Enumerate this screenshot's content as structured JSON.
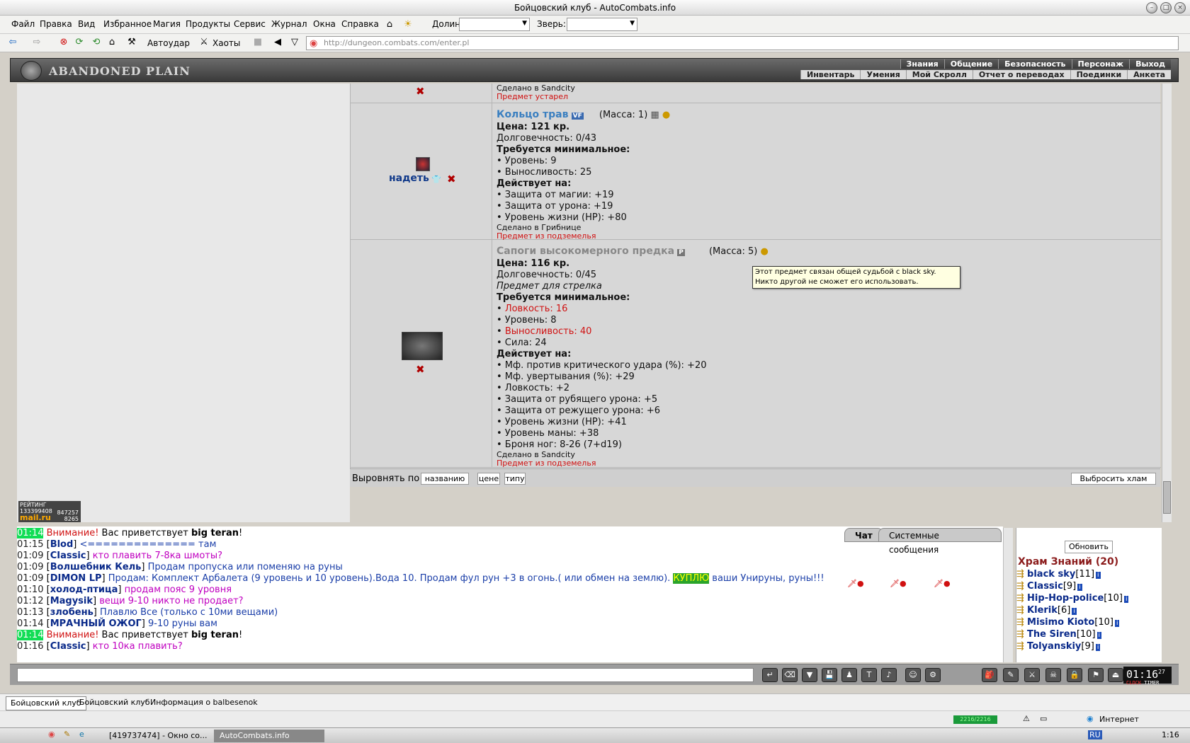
{
  "window": {
    "title": "Бойцовский клуб - AutoCombats.info"
  },
  "menu": {
    "items": [
      "Файл",
      "Правка",
      "Вид",
      "Избранное",
      "Магия",
      "Продукты",
      "Сервис",
      "Журнал",
      "Окна",
      "Справка"
    ],
    "dolin_label": "Долин:",
    "zver_label": "Зверь:"
  },
  "toolbar": {
    "autoudar": "Автоудар",
    "haoty": "Хаоты",
    "url": "http://dungeon.combats.com/enter.pl"
  },
  "game": {
    "logo": "ABANDONED PLAIN",
    "nav_top": [
      "Знания",
      "Общение",
      "Безопасность",
      "Персонаж",
      "Выход"
    ],
    "nav_bottom": [
      "Инвентарь",
      "Умения",
      "Мой Скролл",
      "Отчет о переводах",
      "Поединки",
      "Анкета"
    ]
  },
  "item0": {
    "made": "Сделано в Sandcity",
    "old": "Предмет устарел"
  },
  "item1": {
    "name": "Кольцо трав",
    "badge": "VF",
    "mass": "(Масса: 1)",
    "price": "Цена: 121 кр.",
    "durability": "Долговечность: 0/43",
    "req_title": "Требуется минимальное:",
    "req": [
      "• Уровень: 9",
      "• Выносливость: 25"
    ],
    "acts_title": "Действует на:",
    "acts": [
      "• Защита от магии: +19",
      "• Защита от урона: +19",
      "• Уровень жизни (HP): +80"
    ],
    "made": "Сделано в Грибнице",
    "origin": "Предмет из подземелья",
    "action": "надеть"
  },
  "item2": {
    "name": "Сапоги высокомерного предка",
    "badge": "P",
    "mass": "(Масса: 5)",
    "price": "Цена: 116 кр.",
    "durability": "Долговечность: 0/45",
    "class": "Предмет для стрелка",
    "req_title": "Требуется минимальное:",
    "req_red1": "Ловкость: 16",
    "req2": "• Уровень: 8",
    "req_red2": "Выносливость: 40",
    "req4": "• Сила: 24",
    "acts_title": "Действует на:",
    "acts": [
      "• Мф. против критического удара (%): +20",
      "• Мф. увертывания (%): +29",
      "• Ловкость: +2",
      "• Защита от рубящего урона: +5",
      "• Защита от режущего урона: +6",
      "• Уровень жизни (HP): +41",
      "• Уровень маны: +38",
      "• Броня ног: 8-26 (7+d19)"
    ],
    "made": "Сделано в Sandcity",
    "origin": "Предмет из подземелья"
  },
  "tooltip": "Этот предмет связан общей судьбой с black sky. Никто другой не сможет его использовать.",
  "sort": {
    "label": "Выровнять по",
    "by_name": "названию",
    "by_price": "цене",
    "by_type": "типу",
    "discard": "Выбросить хлам"
  },
  "rating": {
    "line1": "РЕЙТИНГ 133399408",
    "line2": "mail.ru",
    "n1": "847257",
    "n2": "8265"
  },
  "chat": {
    "tabs": [
      "Чат",
      "Системные сообщения"
    ],
    "lines": [
      {
        "time": "01:14",
        "hl": true,
        "attn": "Внимание!",
        "text": " Вас приветствует ",
        "bold": "big teran",
        "end": "!"
      },
      {
        "time": "01:15",
        "nick": "Blod",
        "text": " <============== там",
        "cls": "msgblue"
      },
      {
        "time": "01:09",
        "nick": "CIassic",
        "text": " кто плавить 7-8ка шмоты?",
        "cls": "msgpurp"
      },
      {
        "time": "01:09",
        "nick": "Волшебник Кель",
        "text": " Продам пропуска или поменяю на руны",
        "cls": "msgblue"
      },
      {
        "time": "01:09",
        "nick": "DIMON LP",
        "text": " Продам: Комплект Арбалета (9 уровень и 10 уровень).Вода 10. Продам фул рун +3 в огонь.( или обмен на землю). ",
        "buy": "КУПЛЮ",
        "tail": " ваши Унируны, руны!!!",
        "cls": "msgblue"
      },
      {
        "time": "01:10",
        "nick": "холод-птица",
        "text": " продам пояс 9 уровня",
        "cls": "msgpurp"
      },
      {
        "time": "01:12",
        "nick": "Magysik",
        "text": " вещи 9-10 никто не продает?",
        "cls": "msgpurp"
      },
      {
        "time": "01:13",
        "nick": "злобень",
        "text": " Плавлю Все (только с 10ми вещами)",
        "cls": "msgblue"
      },
      {
        "time": "01:14",
        "nick": "МРАЧНЫЙ ОЖОГ",
        "text": " 9-10 руны вам",
        "cls": "msgblue"
      },
      {
        "time": "01:14",
        "hl": true,
        "attn": "Внимание!",
        "text": " Вас приветствует ",
        "bold": "big teran",
        "end": "!"
      },
      {
        "time": "01:16",
        "nick": "CIassic",
        "text": " кто 10ка плавить?",
        "cls": "msgpurp"
      }
    ]
  },
  "room": {
    "refresh": "Обновить",
    "title": "Храм Знаний (20)",
    "users": [
      {
        "name": "black sky",
        "lvl": "[11]"
      },
      {
        "name": "CIassic",
        "lvl": "[9]"
      },
      {
        "name": "Hip-Hop-police",
        "lvl": "[10]"
      },
      {
        "name": "Klerik",
        "lvl": "[6]"
      },
      {
        "name": "Misimo Kioto",
        "lvl": "[10]"
      },
      {
        "name": "The Siren",
        "lvl": "[10]"
      },
      {
        "name": "Tolyanskiy",
        "lvl": "[9]"
      }
    ]
  },
  "clock": {
    "time": "01:16",
    "sec": "27",
    "labels": [
      "CLOCK",
      "TIMER"
    ]
  },
  "browser_tabs": [
    "Бойцовский клуб",
    "Бойцовский клуб",
    "Информация о balbesenok"
  ],
  "status": {
    "internet": "Интернет",
    "progress": "2216/2216"
  },
  "taskbar": {
    "tasks": [
      "[419737474] - Окно со...",
      "AutoCombats.info"
    ],
    "lang": "RU",
    "time": "1:16"
  }
}
